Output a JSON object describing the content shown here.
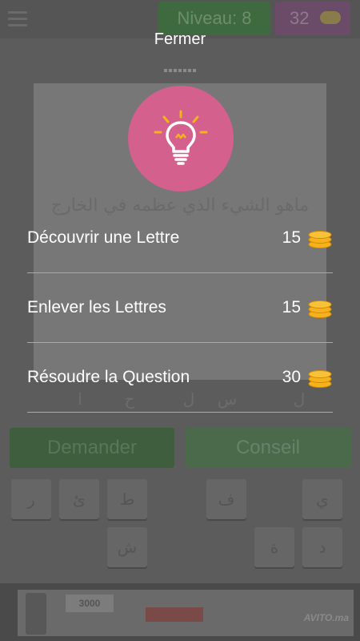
{
  "background": {
    "level_label": "Niveau: 8",
    "coins": "32",
    "question": "ماهو الشيء الذي عظمه في الخارج",
    "answer_letters": [
      "ل",
      "س",
      "ل",
      "ح",
      "ا"
    ],
    "ask_button": "Demander",
    "hint_button": "Conseil",
    "keyboard_row1": [
      "ر",
      "ئ",
      "ط",
      "ف",
      "ي"
    ],
    "keyboard_row2": [
      "ش",
      "ة",
      "د"
    ],
    "ad_price": "3000",
    "ad_brand": "AVITO.ma"
  },
  "dialog": {
    "close_label": "Fermer",
    "icon": "lightbulb-icon",
    "accent_color": "#d4608d",
    "options": [
      {
        "label": "Découvrir une Lettre",
        "cost": "15"
      },
      {
        "label": "Enlever les Lettres",
        "cost": "15"
      },
      {
        "label": "Résoudre la Question",
        "cost": "30"
      }
    ]
  }
}
